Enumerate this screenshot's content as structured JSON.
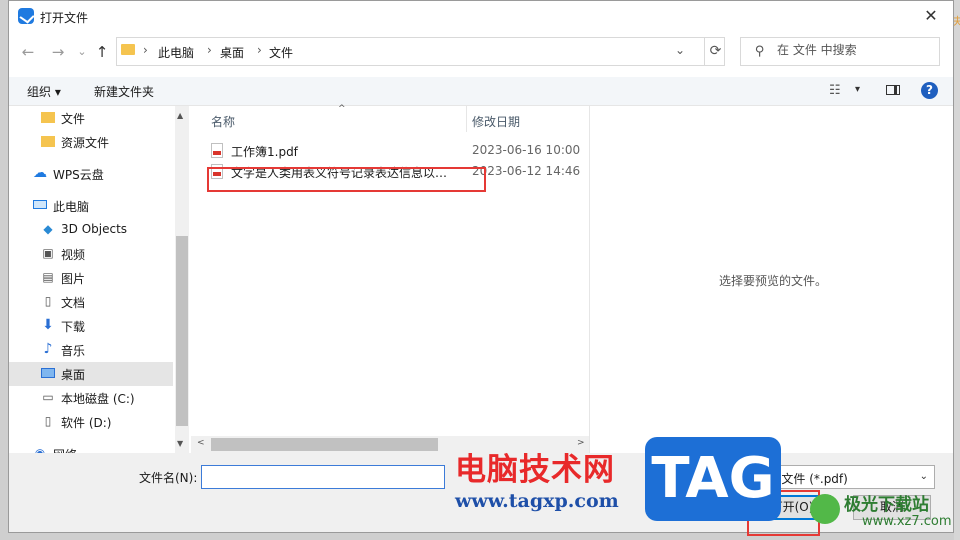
{
  "window": {
    "title": "打开文件",
    "close_glyph": "✕"
  },
  "nav": {
    "back": "←",
    "forward": "→",
    "dropdown": "⌄",
    "up": "↑"
  },
  "address": {
    "crumbs": [
      "此电脑",
      "桌面",
      "文件"
    ],
    "separator": "›",
    "refresh": "⟳",
    "dropdown": "⌄"
  },
  "search": {
    "placeholder": "在 文件 中搜索",
    "icon": "⚲"
  },
  "toolbar": {
    "organize": "组织 ▾",
    "new_folder": "新建文件夹",
    "view_icon": "☷",
    "view_drop": "▾",
    "help": "?"
  },
  "sidebar": {
    "items": [
      {
        "label": "文件",
        "icon": "folder-icon"
      },
      {
        "label": "资源文件",
        "icon": "folder-icon"
      },
      {
        "label": "WPS云盘",
        "icon": "cloud-icon"
      },
      {
        "label": "此电脑",
        "icon": "computer-icon"
      },
      {
        "label": "3D Objects",
        "icon": "cube-icon"
      },
      {
        "label": "视频",
        "icon": "video-icon"
      },
      {
        "label": "图片",
        "icon": "picture-icon"
      },
      {
        "label": "文档",
        "icon": "document-icon"
      },
      {
        "label": "下载",
        "icon": "download-icon"
      },
      {
        "label": "音乐",
        "icon": "music-icon"
      },
      {
        "label": "桌面",
        "icon": "desktop-icon",
        "selected": true
      },
      {
        "label": "本地磁盘 (C:)",
        "icon": "drive-icon"
      },
      {
        "label": "软件 (D:)",
        "icon": "drive-icon"
      },
      {
        "label": "网络",
        "icon": "network-icon"
      }
    ],
    "scroll_up": "▲",
    "scroll_down": "▼"
  },
  "filelist": {
    "columns": {
      "name": "名称",
      "date": "修改日期"
    },
    "sort_arrow": "^",
    "files": [
      {
        "name": "工作簿1.pdf",
        "date": "2023-06-16 10:00"
      },
      {
        "name": "文字是人类用表义符号记录表达信息以传之久远的方式和工具.pdf",
        "date": "2023-06-12 14:46"
      }
    ],
    "hscroll_left": "<",
    "hscroll_right": ">"
  },
  "preview": {
    "text": "选择要预览的文件。"
  },
  "bottom": {
    "filename_label": "文件名(N):",
    "filename_value": "",
    "filetype": "PDF文件 (*.pdf)",
    "filetype_drop": "⌄",
    "open_button": "打开(O)",
    "cancel_button": "取消"
  },
  "watermark": {
    "site_name": "电脑技术网",
    "site_url": "www.tagxp.com",
    "tag": "TAG",
    "jg_name": "极光下载站",
    "jg_url": "www.xz7.com"
  },
  "colors": {
    "accent": "#0078d7",
    "highlight": "#e53935",
    "folder": "#f5c44f"
  }
}
